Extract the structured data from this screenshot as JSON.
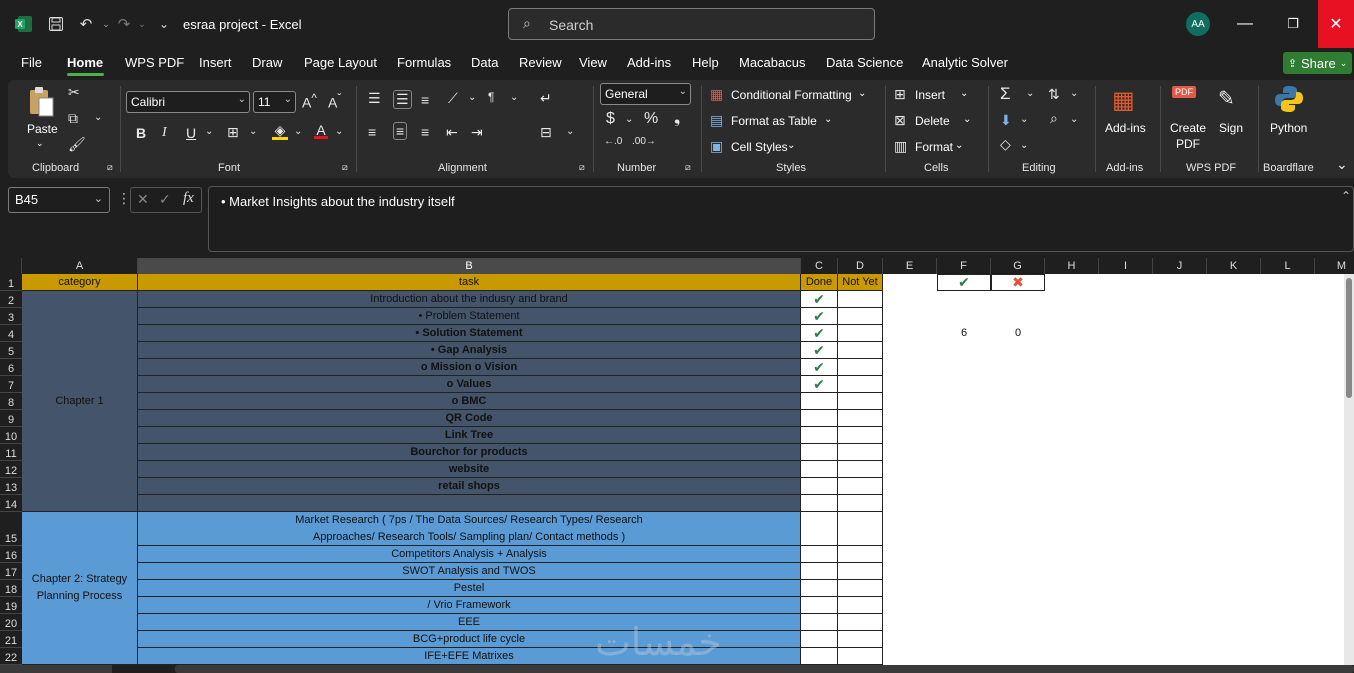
{
  "window": {
    "title": "esraa project  -  Excel",
    "avatar": "AA",
    "search_placeholder": "Search"
  },
  "menu": [
    "File",
    "Home",
    "WPS PDF",
    "Insert",
    "Draw",
    "Page Layout",
    "Formulas",
    "Data",
    "Review",
    "View",
    "Add-ins",
    "Help",
    "Macabacus",
    "Data Science",
    "Analytic Solver"
  ],
  "share_label": "Share",
  "ribbon": {
    "clipboard": {
      "paste": "Paste",
      "label": "Clipboard"
    },
    "font": {
      "name": "Calibri",
      "size": "11",
      "label": "Font"
    },
    "alignment": {
      "label": "Alignment"
    },
    "number": {
      "format": "General",
      "label": "Number"
    },
    "styles": {
      "conditional": "Conditional Formatting",
      "table": "Format as Table",
      "cell_styles": "Cell Styles",
      "label": "Styles"
    },
    "cells": {
      "insert": "Insert",
      "delete": "Delete",
      "format": "Format",
      "label": "Cells"
    },
    "editing": {
      "label": "Editing"
    },
    "addins": {
      "btn": "Add-ins",
      "label": "Add-ins"
    },
    "wps": {
      "create": "Create",
      "pdf": "PDF",
      "sign": "Sign",
      "label": "WPS PDF"
    },
    "boardflare": {
      "python": "Python",
      "label": "Boardflare"
    }
  },
  "namebox": "B45",
  "formula": "• Market Insights about the industry itself",
  "columns": [
    "A",
    "B",
    "C",
    "D",
    "E",
    "F",
    "G",
    "H",
    "I",
    "J",
    "K",
    "L",
    "M"
  ],
  "rows": [
    "1",
    "2",
    "3",
    "4",
    "5",
    "6",
    "7",
    "8",
    "9",
    "10",
    "11",
    "12",
    "13",
    "14",
    "15",
    "16",
    "17",
    "18",
    "19",
    "20",
    "21",
    "22"
  ],
  "header": {
    "category": "category",
    "task": "task",
    "done": "Done",
    "not_yet": "Not Yet"
  },
  "chapter1": "Chapter 1",
  "chapter2": "Chapter 2: Strategy Planning Process",
  "tasks": [
    {
      "text": "Introduction about the indusry and brand",
      "bold": false,
      "done": true
    },
    {
      "text": "• Problem Statement",
      "bold": false,
      "done": true
    },
    {
      "text": "• Solution Statement",
      "bold": true,
      "done": true
    },
    {
      "text": "• Gap Analysis",
      "bold": true,
      "done": true
    },
    {
      "text": "o Mission o Vision",
      "bold": true,
      "done": true
    },
    {
      "text": "o Values",
      "bold": true,
      "done": true
    },
    {
      "text": "o BMC",
      "bold": true,
      "done": false
    },
    {
      "text": "QR Code",
      "bold": true,
      "done": false
    },
    {
      "text": "Link Tree",
      "bold": true,
      "done": false
    },
    {
      "text": "Bourchor for products",
      "bold": true,
      "done": false
    },
    {
      "text": "website",
      "bold": true,
      "done": false
    },
    {
      "text": "retail shops",
      "bold": true,
      "done": false
    },
    {
      "text": "",
      "bold": false,
      "done": false
    },
    {
      "text": "Market Research ( 7ps / The Data Sources/ Research Types/ Research Approaches/ Research Tools/ Sampling plan/ Contact methods )",
      "bold": false,
      "done": false
    },
    {
      "text": "Competitors Analysis + Analysis",
      "bold": false,
      "done": false
    },
    {
      "text": "SWOT Analysis and TWOS",
      "bold": false,
      "done": false
    },
    {
      "text": "Pestel",
      "bold": false,
      "done": false
    },
    {
      "text": "/ Vrio Framework",
      "bold": false,
      "done": false
    },
    {
      "text": "EEE",
      "bold": false,
      "done": false
    },
    {
      "text": "BCG+product life cycle",
      "bold": false,
      "done": false
    },
    {
      "text": "IFE+EFE Matrixes",
      "bold": false,
      "done": false
    }
  ],
  "summary": {
    "done_count": "6",
    "not_yet_count": "0"
  },
  "watermark": "خمسات"
}
